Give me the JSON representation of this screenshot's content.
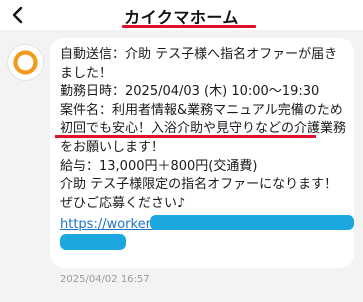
{
  "header": {
    "title": "カイクマホーム"
  },
  "message": {
    "lines": [
      "自動送信：介助 テス子様へ指名オファーが届き",
      "ました！",
      "勤務日時：2025/04/03 (木) 10:00～19:30",
      "案件名：利用者情報&業務マニュアル完備のため",
      "初回でも安心！入浴介助や見守りなどの介護業務",
      "をお願いします！",
      "給与：13,000円＋800円(交通費)",
      "介助 テス子様限定の指名オファーになります！",
      "ぜひご応募ください♪"
    ],
    "link_text": "https://worker.",
    "timestamp": "2025/04/02 16:57"
  },
  "icons": {
    "back": "chevron-left-icon",
    "avatar": "brand-logo-icon"
  },
  "colors": {
    "accent_red": "#e0122b",
    "link_blue": "#1e73c8",
    "redaction_blue": "#1ba8e0",
    "logo_orange": "#f29a1c"
  }
}
